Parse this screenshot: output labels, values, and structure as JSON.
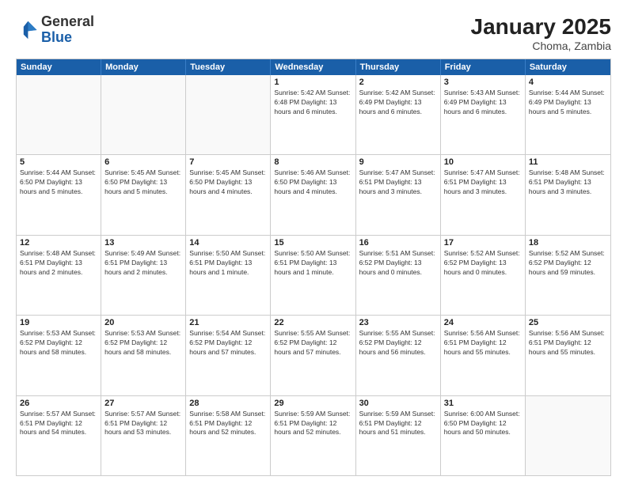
{
  "logo": {
    "general": "General",
    "blue": "Blue"
  },
  "header": {
    "title": "January 2025",
    "subtitle": "Choma, Zambia"
  },
  "weekdays": [
    "Sunday",
    "Monday",
    "Tuesday",
    "Wednesday",
    "Thursday",
    "Friday",
    "Saturday"
  ],
  "weeks": [
    [
      {
        "day": "",
        "info": ""
      },
      {
        "day": "",
        "info": ""
      },
      {
        "day": "",
        "info": ""
      },
      {
        "day": "1",
        "info": "Sunrise: 5:42 AM\nSunset: 6:48 PM\nDaylight: 13 hours and 6 minutes."
      },
      {
        "day": "2",
        "info": "Sunrise: 5:42 AM\nSunset: 6:49 PM\nDaylight: 13 hours and 6 minutes."
      },
      {
        "day": "3",
        "info": "Sunrise: 5:43 AM\nSunset: 6:49 PM\nDaylight: 13 hours and 6 minutes."
      },
      {
        "day": "4",
        "info": "Sunrise: 5:44 AM\nSunset: 6:49 PM\nDaylight: 13 hours and 5 minutes."
      }
    ],
    [
      {
        "day": "5",
        "info": "Sunrise: 5:44 AM\nSunset: 6:50 PM\nDaylight: 13 hours and 5 minutes."
      },
      {
        "day": "6",
        "info": "Sunrise: 5:45 AM\nSunset: 6:50 PM\nDaylight: 13 hours and 5 minutes."
      },
      {
        "day": "7",
        "info": "Sunrise: 5:45 AM\nSunset: 6:50 PM\nDaylight: 13 hours and 4 minutes."
      },
      {
        "day": "8",
        "info": "Sunrise: 5:46 AM\nSunset: 6:50 PM\nDaylight: 13 hours and 4 minutes."
      },
      {
        "day": "9",
        "info": "Sunrise: 5:47 AM\nSunset: 6:51 PM\nDaylight: 13 hours and 3 minutes."
      },
      {
        "day": "10",
        "info": "Sunrise: 5:47 AM\nSunset: 6:51 PM\nDaylight: 13 hours and 3 minutes."
      },
      {
        "day": "11",
        "info": "Sunrise: 5:48 AM\nSunset: 6:51 PM\nDaylight: 13 hours and 3 minutes."
      }
    ],
    [
      {
        "day": "12",
        "info": "Sunrise: 5:48 AM\nSunset: 6:51 PM\nDaylight: 13 hours and 2 minutes."
      },
      {
        "day": "13",
        "info": "Sunrise: 5:49 AM\nSunset: 6:51 PM\nDaylight: 13 hours and 2 minutes."
      },
      {
        "day": "14",
        "info": "Sunrise: 5:50 AM\nSunset: 6:51 PM\nDaylight: 13 hours and 1 minute."
      },
      {
        "day": "15",
        "info": "Sunrise: 5:50 AM\nSunset: 6:51 PM\nDaylight: 13 hours and 1 minute."
      },
      {
        "day": "16",
        "info": "Sunrise: 5:51 AM\nSunset: 6:52 PM\nDaylight: 13 hours and 0 minutes."
      },
      {
        "day": "17",
        "info": "Sunrise: 5:52 AM\nSunset: 6:52 PM\nDaylight: 13 hours and 0 minutes."
      },
      {
        "day": "18",
        "info": "Sunrise: 5:52 AM\nSunset: 6:52 PM\nDaylight: 12 hours and 59 minutes."
      }
    ],
    [
      {
        "day": "19",
        "info": "Sunrise: 5:53 AM\nSunset: 6:52 PM\nDaylight: 12 hours and 58 minutes."
      },
      {
        "day": "20",
        "info": "Sunrise: 5:53 AM\nSunset: 6:52 PM\nDaylight: 12 hours and 58 minutes."
      },
      {
        "day": "21",
        "info": "Sunrise: 5:54 AM\nSunset: 6:52 PM\nDaylight: 12 hours and 57 minutes."
      },
      {
        "day": "22",
        "info": "Sunrise: 5:55 AM\nSunset: 6:52 PM\nDaylight: 12 hours and 57 minutes."
      },
      {
        "day": "23",
        "info": "Sunrise: 5:55 AM\nSunset: 6:52 PM\nDaylight: 12 hours and 56 minutes."
      },
      {
        "day": "24",
        "info": "Sunrise: 5:56 AM\nSunset: 6:51 PM\nDaylight: 12 hours and 55 minutes."
      },
      {
        "day": "25",
        "info": "Sunrise: 5:56 AM\nSunset: 6:51 PM\nDaylight: 12 hours and 55 minutes."
      }
    ],
    [
      {
        "day": "26",
        "info": "Sunrise: 5:57 AM\nSunset: 6:51 PM\nDaylight: 12 hours and 54 minutes."
      },
      {
        "day": "27",
        "info": "Sunrise: 5:57 AM\nSunset: 6:51 PM\nDaylight: 12 hours and 53 minutes."
      },
      {
        "day": "28",
        "info": "Sunrise: 5:58 AM\nSunset: 6:51 PM\nDaylight: 12 hours and 52 minutes."
      },
      {
        "day": "29",
        "info": "Sunrise: 5:59 AM\nSunset: 6:51 PM\nDaylight: 12 hours and 52 minutes."
      },
      {
        "day": "30",
        "info": "Sunrise: 5:59 AM\nSunset: 6:51 PM\nDaylight: 12 hours and 51 minutes."
      },
      {
        "day": "31",
        "info": "Sunrise: 6:00 AM\nSunset: 6:50 PM\nDaylight: 12 hours and 50 minutes."
      },
      {
        "day": "",
        "info": ""
      }
    ]
  ]
}
